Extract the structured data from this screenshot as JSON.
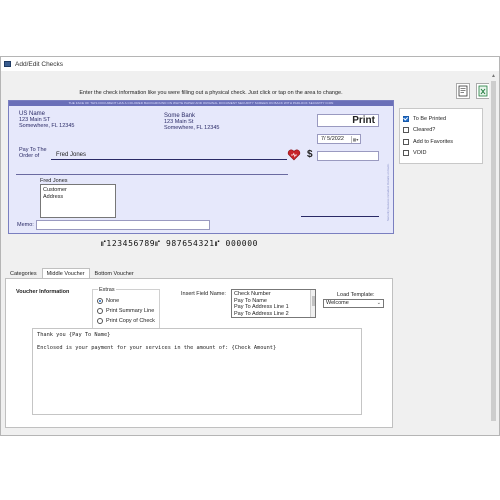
{
  "window": {
    "title": "Add/Edit Checks"
  },
  "instruction": "Enter the check information like you were filling out a physical check. Just click or tap on the area to change.",
  "check": {
    "security_band": "THE FACE OF THIS DOCUMENT HAS A COLORED BACKGROUND ON WHITE PAPER AND ORIGINAL DOCUMENT SECURITY SCREEN ON BACK WITH PADLOCK SECURITY ICON",
    "side_text": "Security features included. Details on back.",
    "payer": {
      "name": "US Name",
      "address1": "123 Main ST",
      "address2": "Somewhere, FL 12345"
    },
    "bank": {
      "name": "Some Bank",
      "address1": "123 Main St",
      "address2": "Somewhere, FL 12345"
    },
    "print_label": "Print",
    "date": "7/ 5/2022",
    "pay_to_label_1": "Pay To The",
    "pay_to_label_2": "Order of",
    "payee": "Fred Jones",
    "dollar_sign": "$",
    "address_name": "Fred Jones",
    "address_line1": "Customer",
    "address_line2": "Address",
    "memo_label": "Memo:",
    "micr_line": "⑈123456789⑈ 987654321⑈ 000000"
  },
  "options": {
    "to_be_printed": {
      "label": "To Be Printed",
      "checked": true
    },
    "cleared": {
      "label": "Cleared?",
      "checked": false
    },
    "add_to_favorites": {
      "label": "Add to Favorites",
      "checked": false
    },
    "void": {
      "label": "VOID",
      "checked": false
    }
  },
  "tabs": [
    {
      "label": "Categories",
      "active": false
    },
    {
      "label": "Middle Voucher",
      "active": true
    },
    {
      "label": "Bottom Voucher",
      "active": false
    }
  ],
  "voucher": {
    "title": "Voucher Information",
    "extras_legend": "Extras",
    "extras_options": [
      "None",
      "Print Summary Line",
      "Print Copy of Check"
    ],
    "extras_selected": "None",
    "insert_field_label": "Insert Field Name:",
    "insert_fields": [
      "Check Number",
      "Pay To Name",
      "Pay To Address Line 1",
      "Pay To Address Line 2"
    ],
    "load_template_label": "Load Template:",
    "template_value": "Welcome",
    "text_line1": "Thank you {Pay To Name}",
    "text_line2": "Enclosed is your payment for your services in the amount of: {Check Amount}"
  },
  "icons": [
    "window-app-icon",
    "print-preview-icon",
    "export-excel-icon",
    "heart-icon",
    "calendar-dropdown-icon"
  ]
}
